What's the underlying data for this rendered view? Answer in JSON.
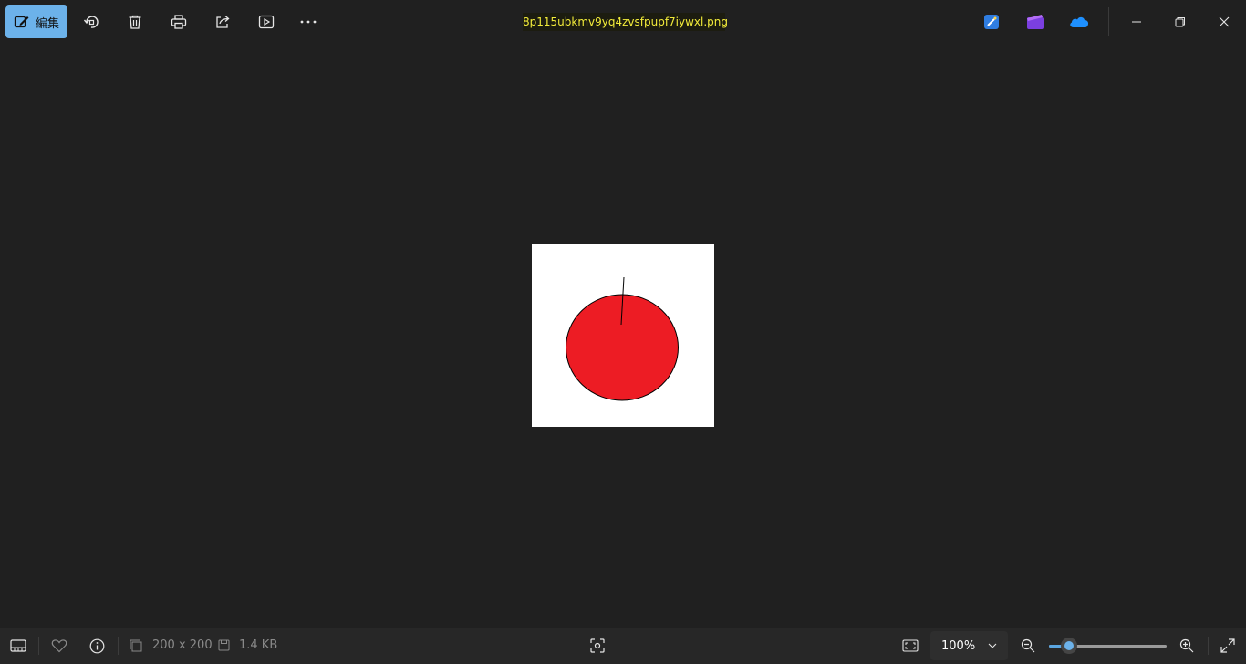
{
  "toolbar": {
    "edit_label": "編集",
    "icons": [
      "edit-icon",
      "rotate-icon",
      "delete-icon",
      "print-icon",
      "share-icon",
      "slideshow-icon",
      "more-icon"
    ]
  },
  "title": {
    "filename": "8p115ubkmv9yq4zvsfpupf7iywxl.png"
  },
  "window": {
    "app_icons": [
      "designer-icon",
      "clipchamp-icon",
      "onedrive-icon"
    ],
    "controls": [
      "minimize-icon",
      "restore-icon",
      "close-icon"
    ]
  },
  "image": {
    "background": "#ffffff",
    "circle_color": "#ed1c24",
    "outline_color": "#000000"
  },
  "statusbar": {
    "dimensions": "200 x 200",
    "file_size": "1.4 KB",
    "zoom": "100%",
    "zoom_fraction": 0.17
  },
  "colors": {
    "accent": "#6cb2ea",
    "filename_text": "#f3ec3a",
    "background": "#202020"
  }
}
